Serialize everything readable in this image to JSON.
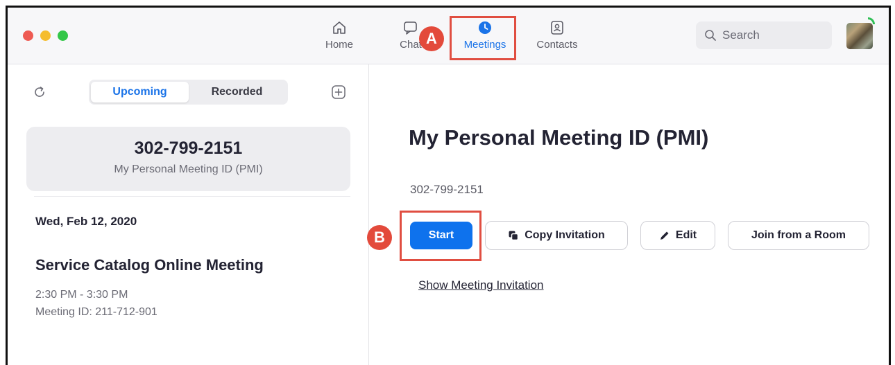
{
  "nav": {
    "home": "Home",
    "chat": "Chat",
    "meetings": "Meetings",
    "contacts": "Contacts"
  },
  "annotations": {
    "a": "A",
    "b": "B"
  },
  "search": {
    "placeholder": "Search"
  },
  "sidebar": {
    "tabs": {
      "upcoming": "Upcoming",
      "recorded": "Recorded"
    },
    "pmi_number": "302-799-2151",
    "pmi_label": "My Personal Meeting ID (PMI)",
    "date": "Wed, Feb 12, 2020",
    "meeting": {
      "title": "Service Catalog Online Meeting",
      "time": "2:30 PM - 3:30 PM",
      "id": "Meeting ID: 211-712-901"
    }
  },
  "main": {
    "title": "My Personal Meeting ID (PMI)",
    "meeting_id": "302-799-2151",
    "buttons": {
      "start": "Start",
      "copy": "Copy Invitation",
      "edit": "Edit",
      "join": "Join from a Room"
    },
    "show_invitation": "Show Meeting Invitation"
  },
  "colors": {
    "accent": "#0e72ed",
    "highlight": "#e04e41"
  }
}
